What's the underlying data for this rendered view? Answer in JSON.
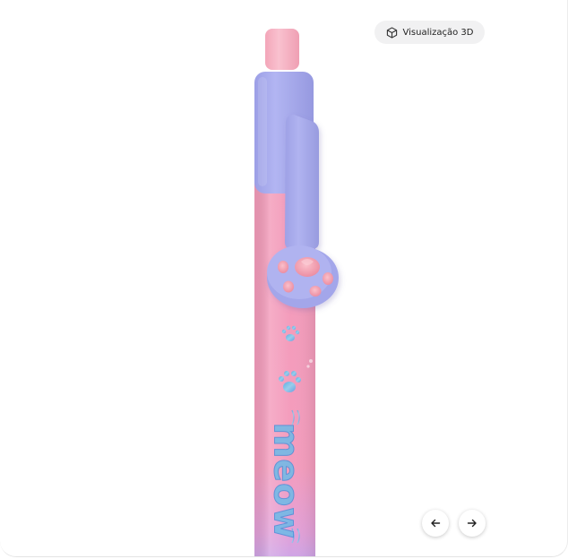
{
  "viewer": {
    "view_3d_label": "Visualização 3D",
    "view_3d_icon": "cube-3d-icon",
    "prev_icon": "arrow-left-icon",
    "next_icon": "arrow-right-icon"
  },
  "product_image": {
    "print_text": "meow",
    "colors": {
      "barrel_pink": "#f49ab8",
      "barrel_lilac": "#c9a6e8",
      "clip_periwinkle": "#a6a9ec",
      "cap_pink": "#f7b5c5",
      "paw_pad_pink": "#f4a0b0",
      "holo_blue": "#5fb6e6"
    }
  }
}
